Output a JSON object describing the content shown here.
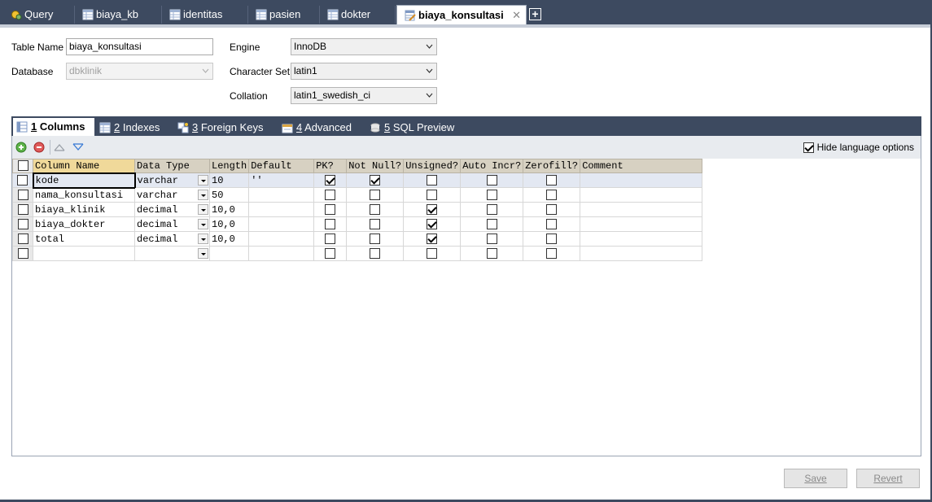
{
  "tabs": [
    {
      "label": "Query",
      "icon": "query-icon"
    },
    {
      "label": "biaya_kb",
      "icon": "table-icon"
    },
    {
      "label": "identitas",
      "icon": "table-icon"
    },
    {
      "label": "pasien",
      "icon": "table-icon"
    },
    {
      "label": "dokter",
      "icon": "table-icon"
    },
    {
      "label": "biaya_konsultasi",
      "icon": "table-edit-icon",
      "active": true
    }
  ],
  "form": {
    "table_name_label": "Table Name",
    "table_name_value": "biaya_konsultasi",
    "database_label": "Database",
    "database_value": "dbklinik",
    "engine_label": "Engine",
    "engine_value": "InnoDB",
    "charset_label": "Character Set",
    "charset_value": "latin1",
    "collation_label": "Collation",
    "collation_value": "latin1_swedish_ci"
  },
  "subtabs": [
    {
      "num": "1",
      "label": "Columns",
      "active": true
    },
    {
      "num": "2",
      "label": "Indexes"
    },
    {
      "num": "3",
      "label": "Foreign Keys"
    },
    {
      "num": "4",
      "label": "Advanced"
    },
    {
      "num": "5",
      "label": "SQL Preview"
    }
  ],
  "toolbar": {
    "hide_language_label": "Hide language options",
    "hide_language_checked": true
  },
  "columns_table": {
    "headers": [
      "Column Name",
      "Data Type",
      "Length",
      "Default",
      "PK?",
      "Not Null?",
      "Unsigned?",
      "Auto Incr?",
      "Zerofill?",
      "Comment"
    ],
    "rows": [
      {
        "name": "kode",
        "type": "varchar",
        "length": "10",
        "default": "''",
        "pk": true,
        "notnull": true,
        "unsigned": false,
        "autoincr": false,
        "zerofill": false,
        "comment": ""
      },
      {
        "name": "nama_konsultasi",
        "type": "varchar",
        "length": "50",
        "default": "",
        "pk": false,
        "notnull": false,
        "unsigned": false,
        "autoincr": false,
        "zerofill": false,
        "comment": ""
      },
      {
        "name": "biaya_klinik",
        "type": "decimal",
        "length": "10,0",
        "default": "",
        "pk": false,
        "notnull": false,
        "unsigned": true,
        "autoincr": false,
        "zerofill": false,
        "comment": ""
      },
      {
        "name": "biaya_dokter",
        "type": "decimal",
        "length": "10,0",
        "default": "",
        "pk": false,
        "notnull": false,
        "unsigned": true,
        "autoincr": false,
        "zerofill": false,
        "comment": ""
      },
      {
        "name": "total",
        "type": "decimal",
        "length": "10,0",
        "default": "",
        "pk": false,
        "notnull": false,
        "unsigned": true,
        "autoincr": false,
        "zerofill": false,
        "comment": ""
      },
      {
        "name": "",
        "type": "",
        "length": "",
        "default": "",
        "pk": false,
        "notnull": false,
        "unsigned": false,
        "autoincr": false,
        "zerofill": false,
        "comment": ""
      }
    ]
  },
  "buttons": {
    "save": "Save",
    "revert": "Revert"
  },
  "colors": {
    "chrome": "#3d4a60",
    "header_bg": "#d7d1c2",
    "selected_header": "#f0d99a",
    "row_highlight": "#e3e8f2"
  }
}
